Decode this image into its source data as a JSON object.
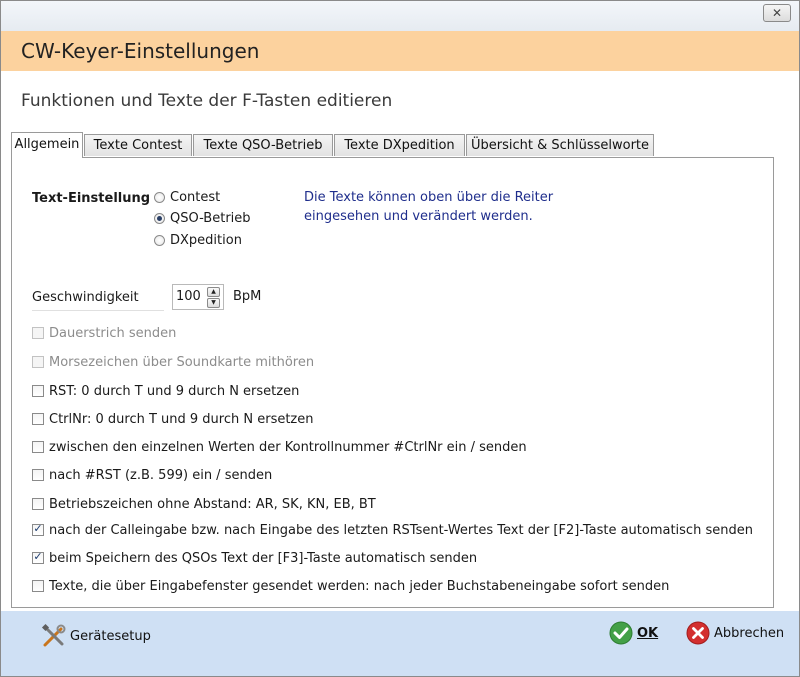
{
  "window": {
    "close_glyph": "✕"
  },
  "header": {
    "title": "CW-Keyer-Einstellungen"
  },
  "subheader": {
    "subtitle": "Funktionen und Texte der F-Tasten editieren"
  },
  "tabs": [
    {
      "label": "Allgemein",
      "active": true
    },
    {
      "label": "Texte Contest",
      "active": false
    },
    {
      "label": "Texte QSO-Betrieb",
      "active": false
    },
    {
      "label": "Texte DXpedition",
      "active": false
    },
    {
      "label": "Übersicht & Schlüsselworte",
      "active": false
    }
  ],
  "text_setting": {
    "label": "Text-Einstellung",
    "options": [
      {
        "label": "Contest",
        "selected": false
      },
      {
        "label": "QSO-Betrieb",
        "selected": true
      },
      {
        "label": "DXpedition",
        "selected": false
      }
    ],
    "info_line1": "Die Texte können oben über die Reiter",
    "info_line2": "eingesehen und verändert werden."
  },
  "speed": {
    "label": "Geschwindigkeit",
    "value": "100",
    "unit": "BpM"
  },
  "checkboxes": [
    {
      "label": "Dauerstrich senden",
      "checked": false,
      "enabled": false
    },
    {
      "label": "Morsezeichen über Soundkarte mithören",
      "checked": false,
      "enabled": false
    },
    {
      "label": "RST: 0 durch T und 9 durch N ersetzen",
      "checked": false,
      "enabled": true
    },
    {
      "label": "CtrlNr: 0 durch T und 9 durch N ersetzen",
      "checked": false,
      "enabled": true
    },
    {
      "label": "zwischen den einzelnen Werten der Kontrollnummer #CtrlNr ein / senden",
      "checked": false,
      "enabled": true
    },
    {
      "label": "nach #RST (z.B. 599) ein / senden",
      "checked": false,
      "enabled": true
    },
    {
      "label": "Betriebszeichen ohne Abstand: AR, SK, KN, EB, BT",
      "checked": false,
      "enabled": true
    },
    {
      "label": "nach der Calleingabe bzw. nach Eingabe des letzten RSTsent-Wertes Text der [F2]-Taste automatisch senden",
      "checked": true,
      "enabled": true
    },
    {
      "label": "beim Speichern des QSOs Text der [F3]-Taste automatisch senden",
      "checked": true,
      "enabled": true
    },
    {
      "label": "Texte, die über Eingabefenster gesendet werden: nach jeder Buchstabeneingabe sofort senden",
      "checked": false,
      "enabled": true
    }
  ],
  "footer": {
    "setup_label": "Gerätesetup",
    "ok_label": "OK",
    "cancel_label": "Abbrechen",
    "check_glyph": "✓"
  },
  "colors": {
    "header_bg": "#fcd29e",
    "footer_bg": "#cfe0f4",
    "info_text": "#1f2e8c"
  }
}
